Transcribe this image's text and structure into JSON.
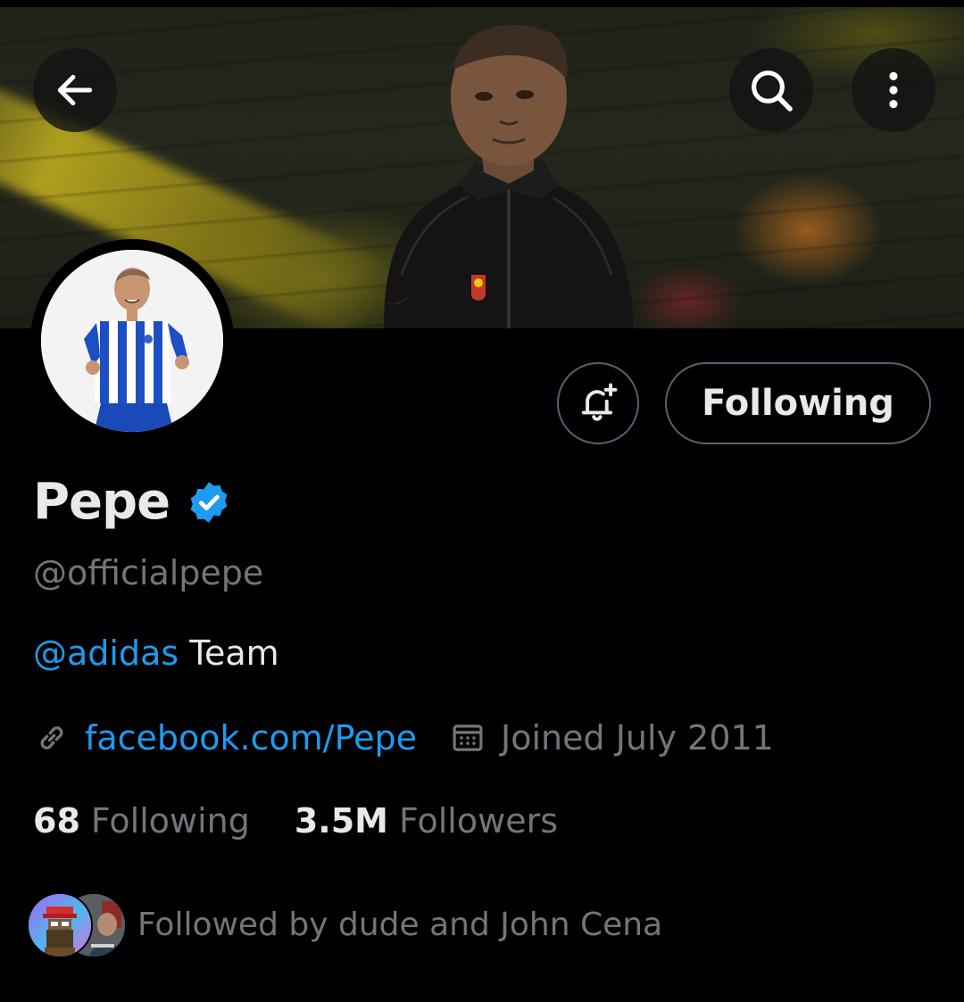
{
  "header": {
    "back_icon": "arrow-left-icon",
    "search_icon": "search-icon",
    "more_icon": "more-vertical-icon"
  },
  "profile": {
    "display_name": "Pepe",
    "verified": true,
    "handle": "@officialpepe",
    "bio_mention": "@adidas",
    "bio_rest": " Team",
    "link": "facebook.com/Pepe",
    "joined": "Joined July 2011",
    "following_count": "68",
    "following_label": "Following",
    "followers_count": "3.5M",
    "followers_label": "Followers",
    "followed_by": "Followed by dude and John Cena"
  },
  "actions": {
    "notify_icon": "bell-plus-icon",
    "following_button": "Following"
  },
  "colors": {
    "accent": "#1d9bf0",
    "background": "#000000",
    "text": "#e7e9ea",
    "muted": "#71767b",
    "border": "#536471"
  }
}
